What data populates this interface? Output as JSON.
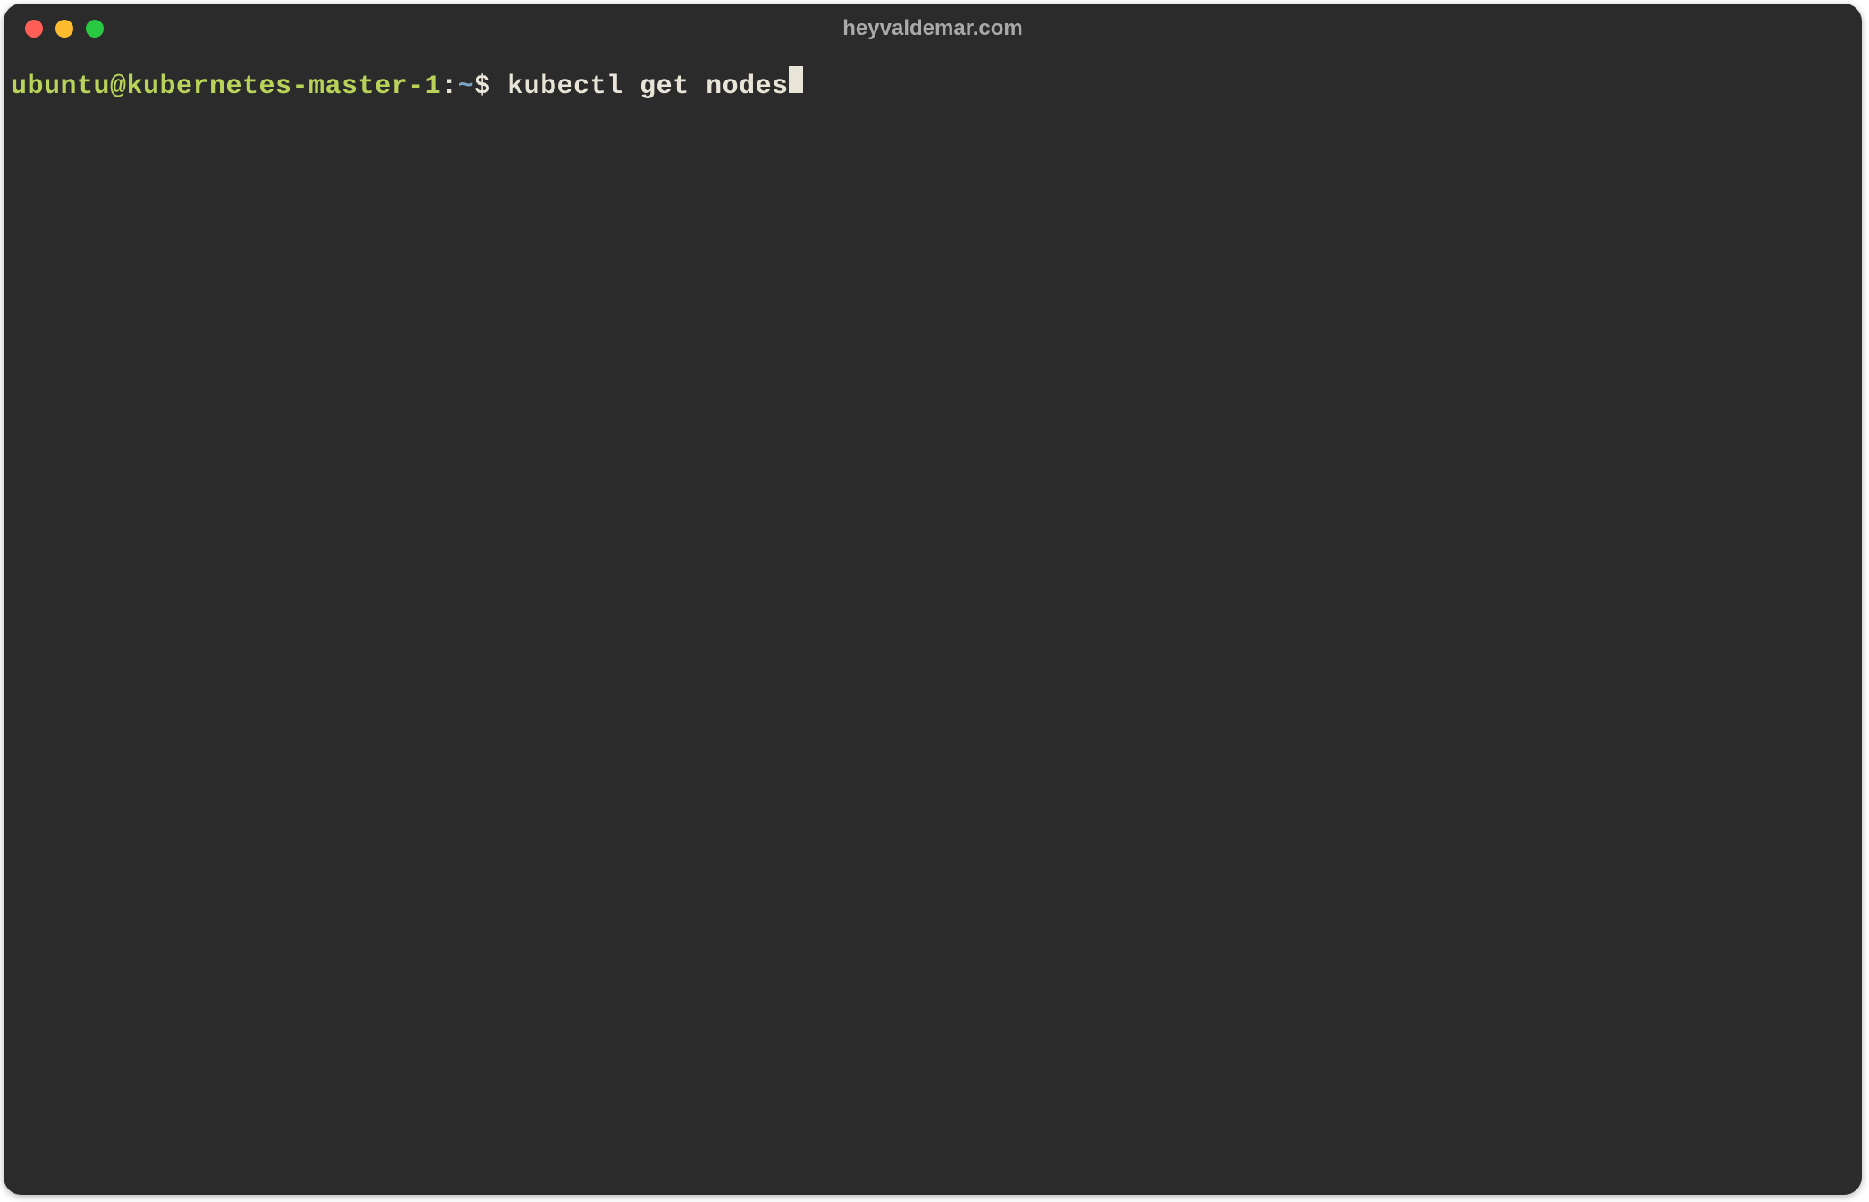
{
  "window": {
    "title": "heyvaldemar.com"
  },
  "colors": {
    "bg": "#2b2b2b",
    "prompt_user": "#b9d35a",
    "prompt_path": "#7aa6c2",
    "text": "#e8e4d8",
    "title": "#a9a9a9",
    "red": "#ff5f57",
    "yellow": "#febc2e",
    "green": "#28c840"
  },
  "terminal": {
    "prompt": {
      "user_host": "ubuntu@kubernetes-master-1",
      "separator": ":",
      "path": "~",
      "symbol": "$"
    },
    "command": " kubectl get nodes"
  }
}
